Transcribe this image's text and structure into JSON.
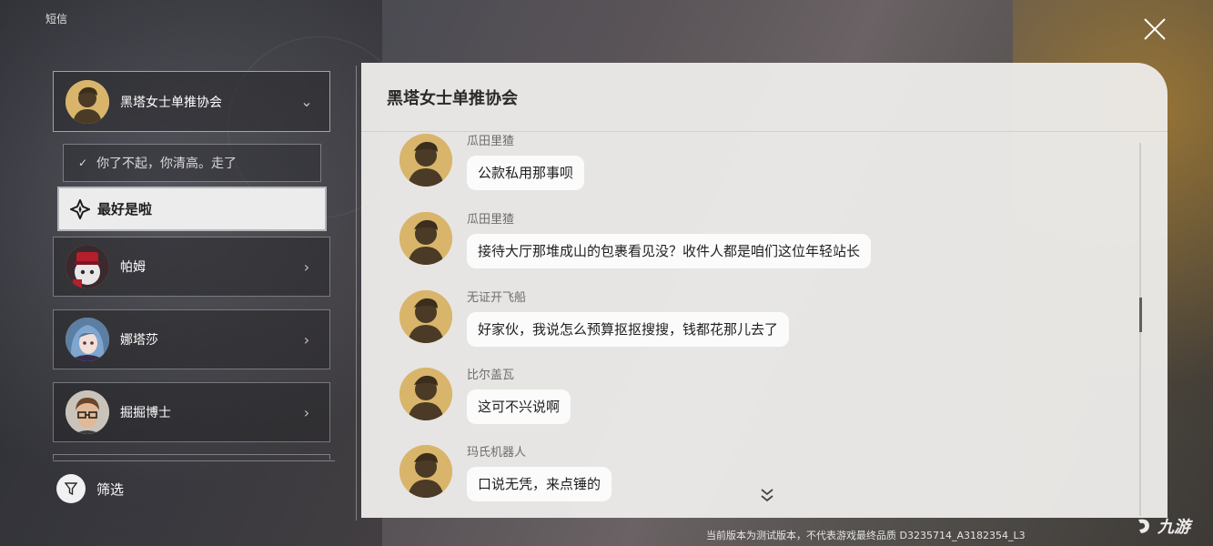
{
  "app": {
    "title": "短信"
  },
  "contacts": [
    {
      "name": "黑塔女士单推协会",
      "expanded": true
    },
    {
      "name": "帕姆"
    },
    {
      "name": "娜塔莎"
    },
    {
      "name": "掘掘博士"
    }
  ],
  "options": {
    "chosen": "你了不起，你清高。走了",
    "selected": "最好是啦"
  },
  "filter": {
    "label": "筛选"
  },
  "chat": {
    "title": "黑塔女士单推协会",
    "messages": [
      {
        "sender": "瓜田里猹",
        "text": "公款私用那事呗"
      },
      {
        "sender": "瓜田里猹",
        "text": "接待大厅那堆成山的包裹看见没？收件人都是咱们这位年轻站长"
      },
      {
        "sender": "无证开飞船",
        "text": "好家伙，我说怎么预算抠抠搜搜，钱都花那儿去了"
      },
      {
        "sender": "比尔盖瓦",
        "text": "这可不兴说啊"
      },
      {
        "sender": "玛氏机器人",
        "text": "口说无凭，来点锤的"
      }
    ]
  },
  "footer": {
    "version_notice": "当前版本为测试版本，不代表游戏最终品质  D3235714_A3182354_L3"
  },
  "watermark": {
    "text": "九游"
  },
  "colors": {
    "avatar_gold": "#d8b56a",
    "panel_bg": "#ecebe9",
    "bubble_bg": "#fbfbfb",
    "selected_option_bg": "#ececec"
  }
}
